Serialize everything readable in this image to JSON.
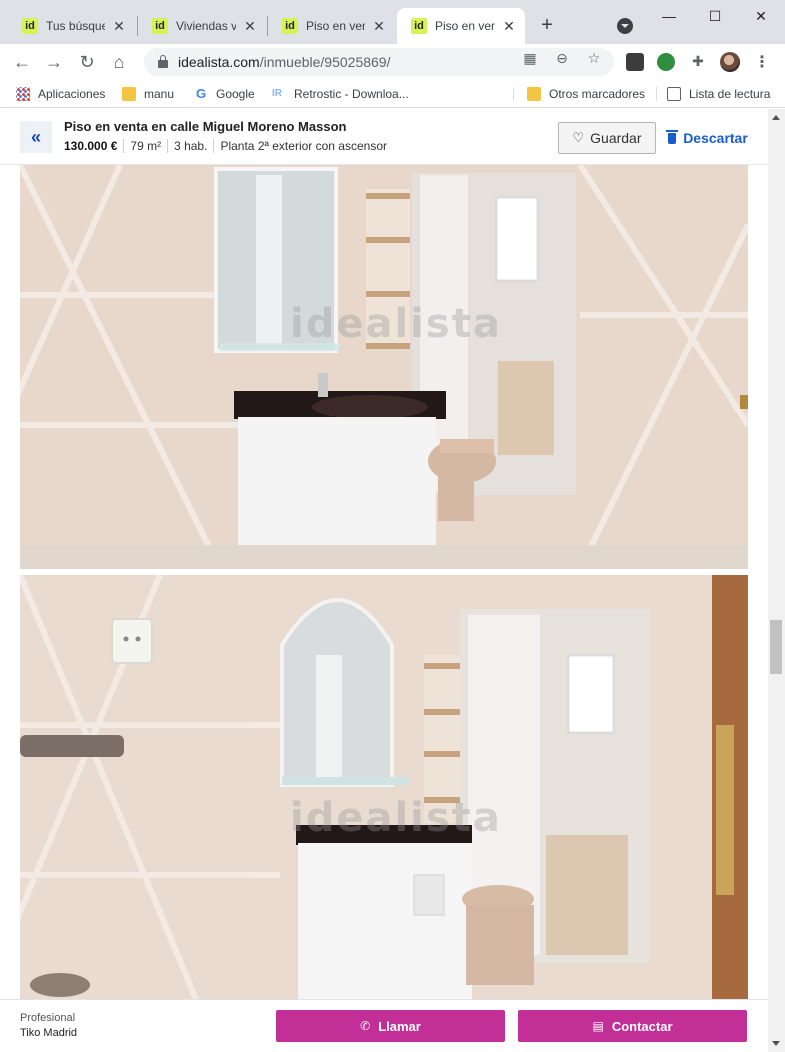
{
  "browser": {
    "tabs": [
      {
        "label": "Tus búsqued",
        "favicon": "id"
      },
      {
        "label": "Viviendas ve",
        "favicon": "id"
      },
      {
        "label": "Piso en vent",
        "favicon": "id"
      },
      {
        "label": "Piso en vent",
        "favicon": "id",
        "active": true
      }
    ],
    "new_tab_icon": "+",
    "window_controls": {
      "minimize": "—",
      "maximize": "☐",
      "close": "✕"
    },
    "url_host": "idealista.com",
    "url_path": "/inmueble/95025869/",
    "bookmarks": [
      {
        "label": "Aplicaciones",
        "icon": "apps-grid-icon"
      },
      {
        "label": "manu",
        "icon": "folder-icon"
      },
      {
        "label": "Google",
        "icon": "google-icon"
      },
      {
        "label": "Retrostic - Downloa...",
        "icon": "retrostic-icon"
      },
      {
        "label": "Otros marcadores",
        "icon": "folder-icon"
      },
      {
        "label": "Lista de lectura",
        "icon": "reading-list-icon"
      }
    ]
  },
  "listing": {
    "title": "Piso en venta en calle Miguel Moreno Masson",
    "price": "130.000 €",
    "size": "79 m²",
    "rooms": "3 hab.",
    "floor": "Planta 2ª exterior con ascensor",
    "save_label": "Guardar",
    "discard_label": "Descartar",
    "back_icon": "«"
  },
  "photos": {
    "watermark": "idealista"
  },
  "footer": {
    "agent_type": "Profesional",
    "agent_name": "Tiko Madrid",
    "call_label": "Llamar",
    "contact_label": "Contactar"
  },
  "colors": {
    "brand_cta": "#c22f97",
    "link_blue": "#1a5ccb",
    "favicon_yellow": "#d7f254"
  }
}
